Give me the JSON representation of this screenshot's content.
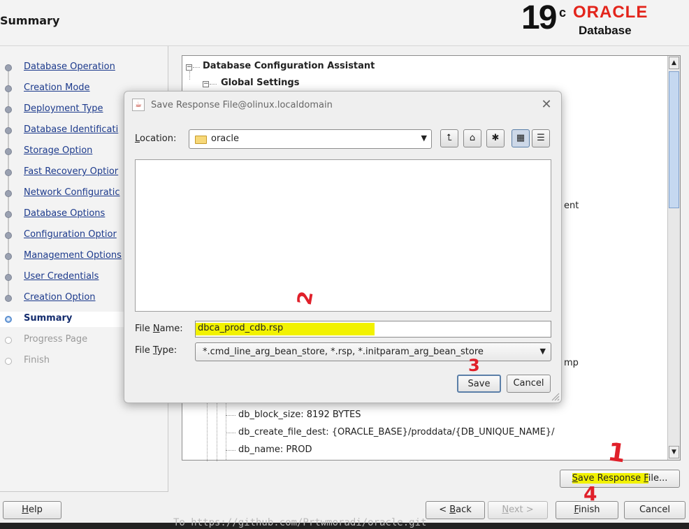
{
  "header": {
    "title": "Summary",
    "logo": {
      "version": "19",
      "superscript": "c",
      "brand": "ORACLE",
      "registered": "®",
      "product": "Database",
      "brand_color": "#e3241b"
    }
  },
  "nav": {
    "items": [
      {
        "label": "Database Operation",
        "state": "done"
      },
      {
        "label": "Creation Mode",
        "state": "done"
      },
      {
        "label": "Deployment Type",
        "state": "done"
      },
      {
        "label": "Database Identificati",
        "state": "done"
      },
      {
        "label": "Storage Option",
        "state": "done"
      },
      {
        "label": "Fast Recovery Optior",
        "state": "done"
      },
      {
        "label": "Network Configuratic",
        "state": "done"
      },
      {
        "label": "Database Options",
        "state": "done"
      },
      {
        "label": "Configuration Optior",
        "state": "done"
      },
      {
        "label": "Management Options",
        "state": "done"
      },
      {
        "label": "User Credentials",
        "state": "done"
      },
      {
        "label": "Creation Option",
        "state": "done"
      },
      {
        "label": "Summary",
        "state": "current"
      },
      {
        "label": "Progress Page",
        "state": "future"
      },
      {
        "label": "Finish",
        "state": "future"
      }
    ]
  },
  "tree": {
    "root": "Database Configuration Assistant",
    "global": "Global Settings",
    "partial_1": "ent",
    "partial_2": "mp",
    "db_block_size": "db_block_size: 8192 BYTES",
    "db_create_file_dest": "db_create_file_dest: {ORACLE_BASE}/proddata/{DB_UNIQUE_NAME}/",
    "db_name": "db_name: PROD"
  },
  "buttons": {
    "save_response": {
      "pre": "",
      "s": "S",
      "mid": "ave Response ",
      "f": "F",
      "post": "ile..."
    },
    "help": {
      "h": "H",
      "rest": "elp"
    },
    "back": {
      "pre": "< ",
      "b": "B",
      "rest": "ack"
    },
    "next": {
      "n": "N",
      "rest": "ext >"
    },
    "finish": {
      "f": "F",
      "rest": "inish"
    },
    "cancel": "Cancel"
  },
  "dialog": {
    "title": "Save Response File@olinux.localdomain",
    "close_glyph": "✕",
    "location_label": {
      "l": "L",
      "rest": "ocation:"
    },
    "location_value": "oracle",
    "tools": [
      "⮤",
      "⌂",
      "✱",
      "▦",
      "☰"
    ],
    "filename_label": {
      "pre": "File ",
      "n": "N",
      "rest": "ame:"
    },
    "filename_value": "dbca_prod_cdb.rsp",
    "filetype_label": {
      "pre": "File ",
      "t": "T",
      "rest": "ype:"
    },
    "filetype_value": "*.cmd_line_arg_bean_store, *.rsp, *.initparam_arg_bean_store",
    "save": "Save",
    "cancel": "Cancel"
  },
  "annotations": {
    "one": "1",
    "two": "2",
    "three": "3",
    "four": "4"
  },
  "terminal_text": "To https://github.com/Prtwmoradi/oracle.git"
}
